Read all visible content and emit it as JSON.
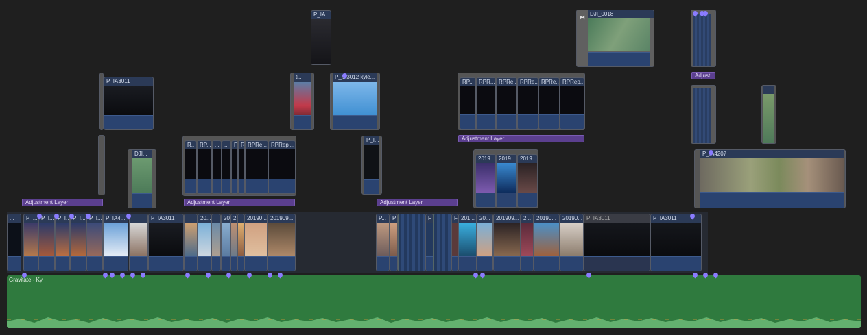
{
  "timeline": {
    "top_clips": [
      {
        "id": "clip-pia-top",
        "label": "P_IA..."
      },
      {
        "id": "clip-dji",
        "label": "DJI_0018"
      },
      {
        "id": "clip-pia3011-a",
        "label": "P_IA3011"
      },
      {
        "id": "clip-ti",
        "label": "ti..."
      },
      {
        "id": "clip-pia3012",
        "label": "P_IA3012 kyle..."
      },
      {
        "id": "clip-rpr-1",
        "label": "RP..."
      },
      {
        "id": "clip-rpr-2",
        "label": "RPR..."
      },
      {
        "id": "clip-rpr-3",
        "label": "RPRe..."
      },
      {
        "id": "clip-rpr-4",
        "label": "RPRe..."
      },
      {
        "id": "clip-rpr-5",
        "label": "RPRe..."
      },
      {
        "id": "clip-rpr-6",
        "label": "RPRep..."
      },
      {
        "id": "clip-dji-small",
        "label": "DJI..."
      },
      {
        "id": "clip-r-1",
        "label": "R..."
      },
      {
        "id": "clip-rp-1",
        "label": "RP..."
      },
      {
        "id": "clip-dots-1",
        "label": "..."
      },
      {
        "id": "clip-dots-2",
        "label": "..."
      },
      {
        "id": "clip-f",
        "label": "F"
      },
      {
        "id": "clip-ri",
        "label": "RI"
      },
      {
        "id": "clip-rpre",
        "label": "RPRe..."
      },
      {
        "id": "clip-rprepl",
        "label": "RPRepl..."
      },
      {
        "id": "clip-pi-mid",
        "label": "P_I..."
      },
      {
        "id": "clip-2019-a",
        "label": "2019..."
      },
      {
        "id": "clip-2019-b",
        "label": "2019..."
      },
      {
        "id": "clip-2019-c",
        "label": "2019..."
      },
      {
        "id": "clip-pia4207",
        "label": "P_IA4207"
      }
    ],
    "adjustment_layers": [
      {
        "label": "Adjustment Layer"
      },
      {
        "label": "Adjustment Layer"
      },
      {
        "label": "Adjustment Layer"
      },
      {
        "label": "Adjustment Layer"
      },
      {
        "label": "Adjust..."
      }
    ],
    "primary": [
      {
        "label": "..."
      },
      {
        "label": "P_..."
      },
      {
        "label": "P_I..."
      },
      {
        "label": "P_I..."
      },
      {
        "label": "P_I..."
      },
      {
        "label": "P_I..."
      },
      {
        "label": "P_IA4..."
      },
      {
        "label": "P_IA3011"
      },
      {
        "label": "20..."
      },
      {
        "label": "20..."
      },
      {
        "label": "2("
      },
      {
        "label": "20190..."
      },
      {
        "label": "201909..."
      },
      {
        "label": "P..."
      },
      {
        "label": "P"
      },
      {
        "label": "F"
      },
      {
        "label": "F"
      },
      {
        "label": "201..."
      },
      {
        "label": "20..."
      },
      {
        "label": "201909..."
      },
      {
        "label": "2..."
      },
      {
        "label": "20190..."
      },
      {
        "label": "20190..."
      },
      {
        "label": "P_IA3011"
      },
      {
        "label": "P_IA3011"
      }
    ],
    "audio": {
      "label": "Gravitate - Ky."
    },
    "colors": {
      "accent": "#8a7cff",
      "adjustment": "#5b3f8f",
      "audio": "#2f7a3e",
      "clip_header": "#2b3a57"
    }
  }
}
